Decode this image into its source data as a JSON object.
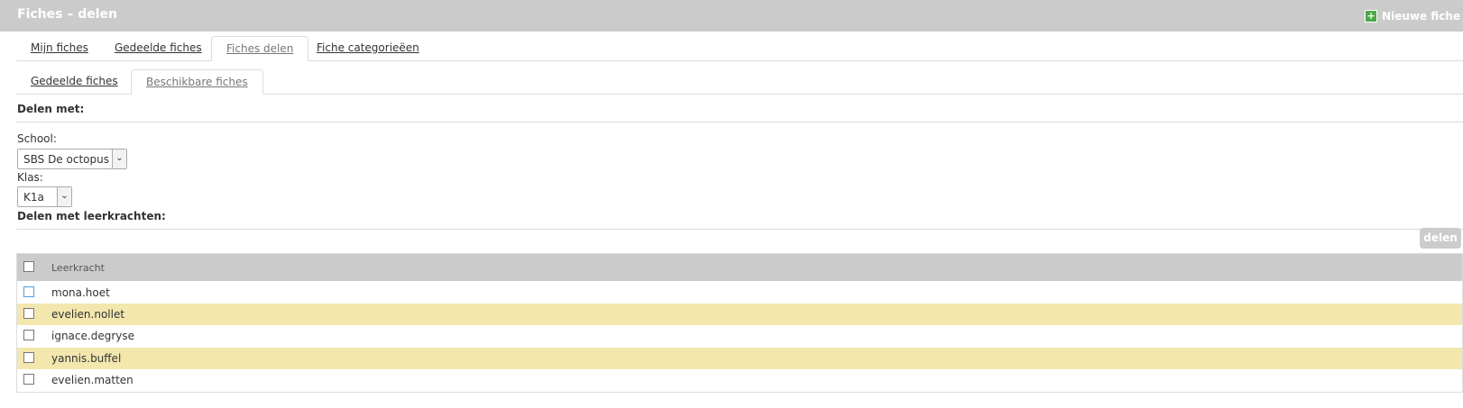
{
  "header": {
    "title": "Fiches – delen",
    "new_button": "Nieuwe fiche"
  },
  "main_tabs": [
    {
      "label": "Mijn fiches",
      "active": false
    },
    {
      "label": "Gedeelde fiches",
      "active": false
    },
    {
      "label": "Fiches delen",
      "active": true
    },
    {
      "label": "Fiche categorieëen",
      "active": false
    }
  ],
  "sub_tabs": [
    {
      "label": "Gedeelde fiches",
      "active": false
    },
    {
      "label": "Beschikbare fiches",
      "active": true
    }
  ],
  "share_section": {
    "title": "Delen met:",
    "school_label": "School:",
    "school_value": "SBS De octopus",
    "class_label": "Klas:",
    "class_value": "K1a"
  },
  "teachers_section": {
    "title": "Delen met leerkrachten:",
    "share_button": "delen",
    "column_header": "Leerkracht",
    "rows": [
      {
        "name": "mona.hoet",
        "checked": false
      },
      {
        "name": "evelien.nollet",
        "checked": false
      },
      {
        "name": "ignace.degryse",
        "checked": false
      },
      {
        "name": "yannis.buffel",
        "checked": false
      },
      {
        "name": "evelien.matten",
        "checked": false
      }
    ]
  },
  "colors": {
    "header_bg": "#cbcbcb",
    "alt_row": "#f3e7ae",
    "plus_icon": "#4aa84a"
  }
}
